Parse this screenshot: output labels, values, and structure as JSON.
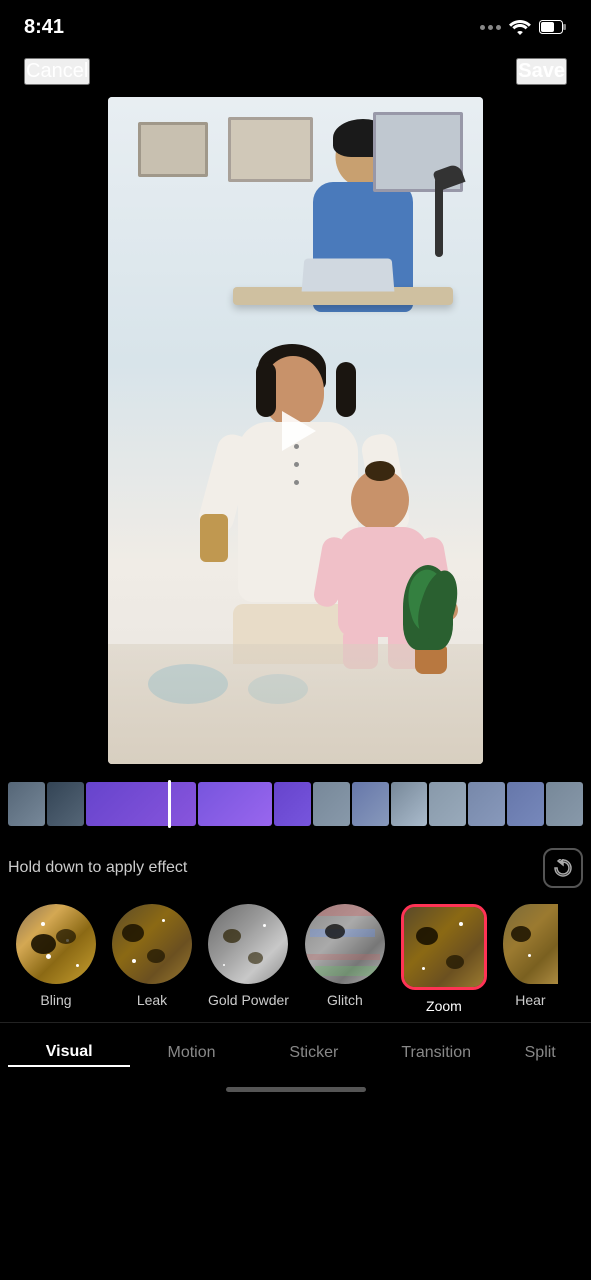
{
  "statusBar": {
    "time": "8:41",
    "batteryLevel": 60
  },
  "header": {
    "cancelLabel": "Cancel",
    "saveLabel": "Save"
  },
  "video": {
    "playButtonVisible": true
  },
  "timeline": {
    "holdDownText": "Hold down to apply effect",
    "undoLabel": "↺"
  },
  "effects": [
    {
      "id": "bling",
      "label": "Bling",
      "bgClass": "bling-bg",
      "selected": false
    },
    {
      "id": "leak",
      "label": "Leak",
      "bgClass": "leak-bg",
      "selected": false
    },
    {
      "id": "gold-powder",
      "label": "Gold Powder",
      "bgClass": "goldpowder-bg",
      "selected": false
    },
    {
      "id": "glitch",
      "label": "Glitch",
      "bgClass": "glitch-bg",
      "selected": false
    },
    {
      "id": "zoom",
      "label": "Zoom",
      "bgClass": "zoom-bg",
      "selected": true
    },
    {
      "id": "hear",
      "label": "Hear",
      "bgClass": "hear-bg",
      "selected": false,
      "partial": true
    }
  ],
  "tabs": [
    {
      "id": "visual",
      "label": "Visual",
      "active": true
    },
    {
      "id": "motion",
      "label": "Motion",
      "active": false
    },
    {
      "id": "sticker",
      "label": "Sticker",
      "active": false
    },
    {
      "id": "transition",
      "label": "Transition",
      "active": false
    },
    {
      "id": "split",
      "label": "Split",
      "active": false,
      "partial": true
    }
  ]
}
